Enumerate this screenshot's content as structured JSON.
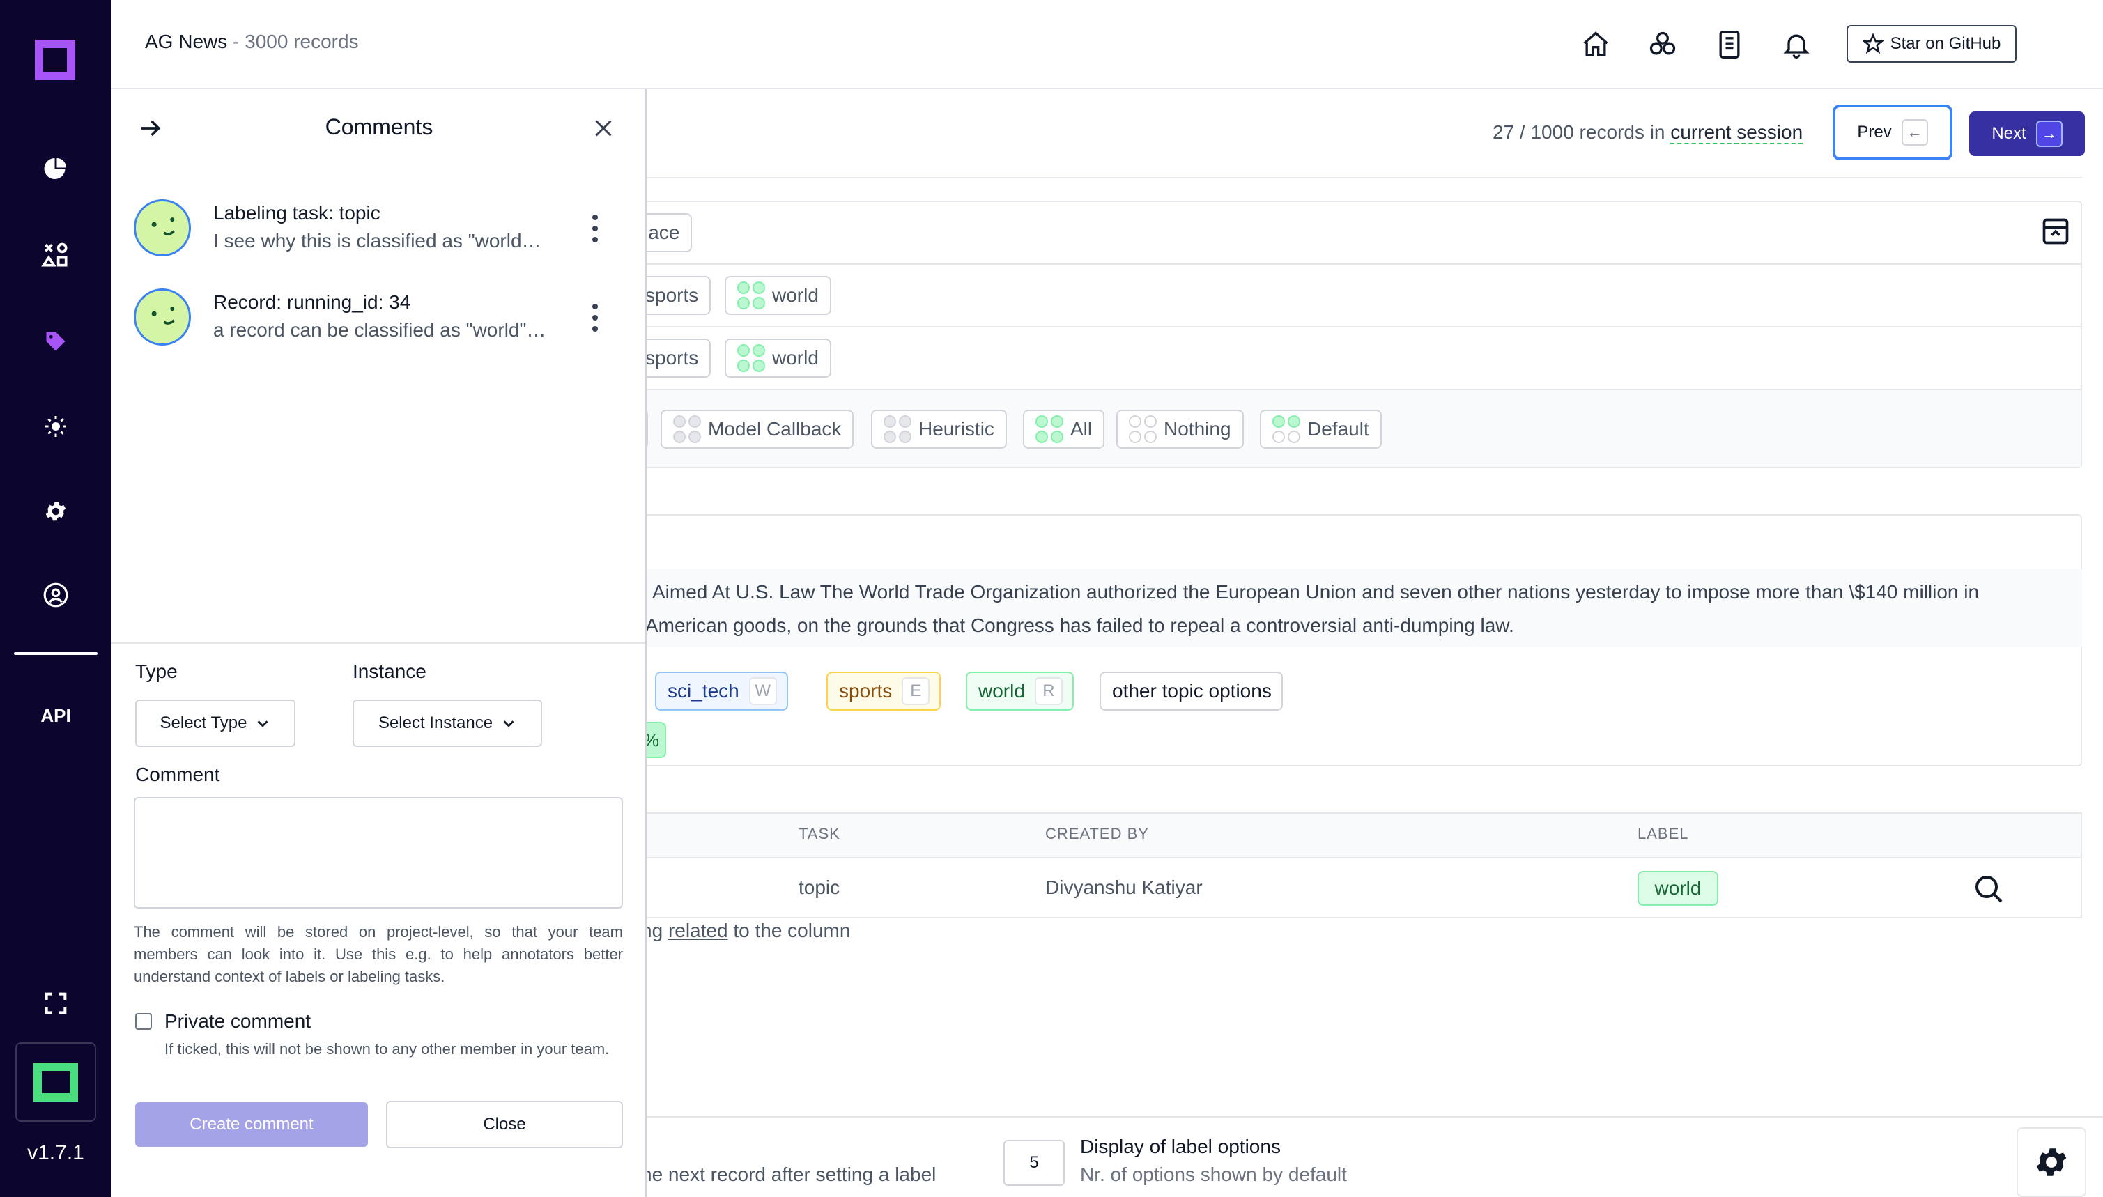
{
  "sidebar": {
    "api_label": "API",
    "version": "v1.7.1",
    "nav": [
      {
        "name": "overview-icon"
      },
      {
        "name": "heuristics-icon"
      },
      {
        "name": "labeling-icon"
      },
      {
        "name": "models-icon"
      },
      {
        "name": "settings-icon"
      },
      {
        "name": "admin-icon"
      }
    ]
  },
  "header": {
    "project_name": "AG News",
    "separator": " - ",
    "record_count": "3000 records",
    "github_label": "Star on GitHub"
  },
  "session": {
    "position": "27 / 1000 records in ",
    "link": "current session",
    "prev_label": "Prev",
    "next_label": "Next"
  },
  "main": {
    "row1_partial": "lace",
    "row2_chips": [
      "sports",
      "world"
    ],
    "row3_chips": [
      "sports",
      "world"
    ],
    "filter_chips": [
      "Model Callback",
      "Heuristic",
      "All",
      "Nothing",
      "Default"
    ],
    "record_line1": "Aimed At U.S. Law The World Trade Organization authorized the European Union and seven other nations yesterday to impose more than \\$140 million in",
    "record_line2": "American goods, on the grounds that Congress has failed to repeal a controversial anti-dumping law.",
    "labels": [
      {
        "label": "sci_tech",
        "key": "W"
      },
      {
        "label": "sports",
        "key": "E"
      },
      {
        "label": "world",
        "key": "R"
      }
    ],
    "other_options": "other topic options",
    "pct_partial": "%",
    "table": {
      "headers": [
        "TASK",
        "CREATED BY",
        "LABEL"
      ],
      "row": {
        "task": "topic",
        "created_by": "Divyanshu Katiyar",
        "label": "world"
      }
    },
    "hint_pre": "ng ",
    "hint_link": "related",
    "hint_post": " to the column",
    "bottom_text": "he next record after setting a label",
    "display_count": "5",
    "display_title": "Display of label options",
    "display_sub": "Nr. of options shown by default"
  },
  "comments": {
    "title": "Comments",
    "items": [
      {
        "title": "Labeling task: topic",
        "text": "I see why this is classified as \"world\", but this also has aspects of business"
      },
      {
        "title": "Record: running_id: 34",
        "text": "a record can be classified as \"world\" if it mentions other countries"
      }
    ],
    "type_label": "Type",
    "type_select": "Select Type",
    "instance_label": "Instance",
    "instance_select": "Select Instance",
    "comment_label": "Comment",
    "help": "The comment will be stored on project-level, so that your team members can look into it. Use this e.g. to help annotators better understand context of labels or labeling tasks.",
    "private_label": "Private comment",
    "private_help": "If ticked, this will not be shown to any other member in your team.",
    "create_label": "Create comment",
    "close_label": "Close"
  }
}
